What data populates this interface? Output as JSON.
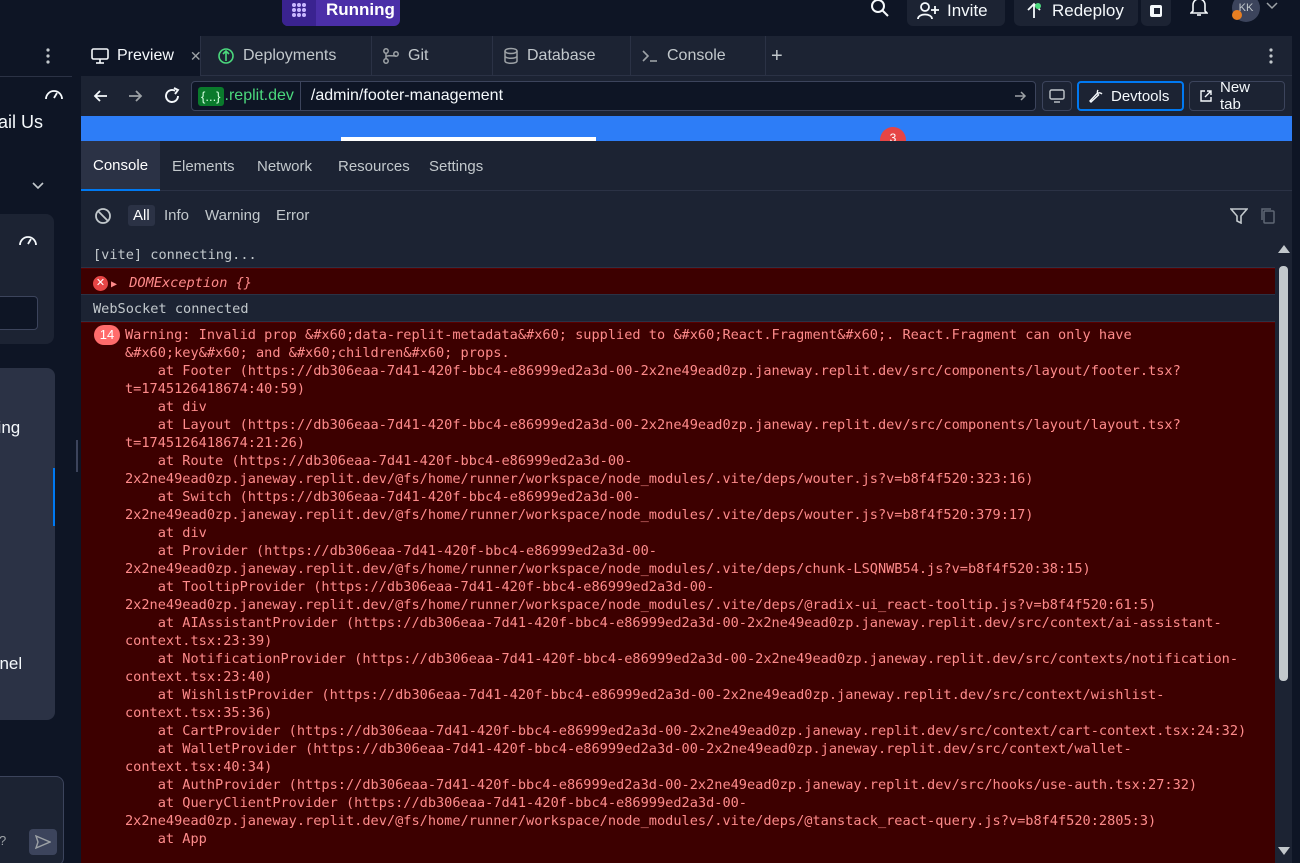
{
  "topbar": {
    "run_label": "Running",
    "invite_label": "Invite",
    "redeploy_label": "Redeploy",
    "avatar_initials": "KK"
  },
  "leftpane": {
    "text1": "ail Us",
    "text2": "iling",
    "text3": "anel",
    "input_placeholder": "?"
  },
  "tabs": [
    {
      "label": "Preview",
      "icon": "monitor-icon"
    },
    {
      "label": "Deployments",
      "icon": "deployments-icon"
    },
    {
      "label": "Git",
      "icon": "git-icon"
    },
    {
      "label": "Database",
      "icon": "database-icon"
    },
    {
      "label": "Console",
      "icon": "console-icon"
    }
  ],
  "urlbar": {
    "host_badge": "{...}",
    "host": ".replit.dev",
    "path": "/admin/footer-management",
    "devtools_label": "Devtools",
    "newtab_label": "New tab"
  },
  "blue_strip": {
    "notification_count": "3"
  },
  "devtools_tabs": [
    "Console",
    "Elements",
    "Network",
    "Resources",
    "Settings"
  ],
  "filters": [
    "All",
    "Info",
    "Warning",
    "Error"
  ],
  "console": {
    "line1": "[vite] connecting...",
    "line2": "DOMException {}",
    "line3": "WebSocket connected",
    "warning_count": "14",
    "warning_text": "Warning: Invalid prop &#x60;data-replit-metadata&#x60; supplied to &#x60;React.Fragment&#x60;. React.Fragment can only have\n&#x60;key&#x60; and &#x60;children&#x60; props.\n    at Footer (https://db306eaa-7d41-420f-bbc4-e86999ed2a3d-00-2x2ne49ead0zp.janeway.replit.dev/src/components/layout/footer.tsx?\nt=1745126418674:40:59)\n    at div\n    at Layout (https://db306eaa-7d41-420f-bbc4-e86999ed2a3d-00-2x2ne49ead0zp.janeway.replit.dev/src/components/layout/layout.tsx?\nt=1745126418674:21:26)\n    at Route (https://db306eaa-7d41-420f-bbc4-e86999ed2a3d-00-\n2x2ne49ead0zp.janeway.replit.dev/@fs/home/runner/workspace/node_modules/.vite/deps/wouter.js?v=b8f4f520:323:16)\n    at Switch (https://db306eaa-7d41-420f-bbc4-e86999ed2a3d-00-\n2x2ne49ead0zp.janeway.replit.dev/@fs/home/runner/workspace/node_modules/.vite/deps/wouter.js?v=b8f4f520:379:17)\n    at div\n    at Provider (https://db306eaa-7d41-420f-bbc4-e86999ed2a3d-00-\n2x2ne49ead0zp.janeway.replit.dev/@fs/home/runner/workspace/node_modules/.vite/deps/chunk-LSQNWB54.js?v=b8f4f520:38:15)\n    at TooltipProvider (https://db306eaa-7d41-420f-bbc4-e86999ed2a3d-00-\n2x2ne49ead0zp.janeway.replit.dev/@fs/home/runner/workspace/node_modules/.vite/deps/@radix-ui_react-tooltip.js?v=b8f4f520:61:5)\n    at AIAssistantProvider (https://db306eaa-7d41-420f-bbc4-e86999ed2a3d-00-2x2ne49ead0zp.janeway.replit.dev/src/context/ai-assistant-\ncontext.tsx:23:39)\n    at NotificationProvider (https://db306eaa-7d41-420f-bbc4-e86999ed2a3d-00-2x2ne49ead0zp.janeway.replit.dev/src/contexts/notification-\ncontext.tsx:23:40)\n    at WishlistProvider (https://db306eaa-7d41-420f-bbc4-e86999ed2a3d-00-2x2ne49ead0zp.janeway.replit.dev/src/context/wishlist-\ncontext.tsx:35:36)\n    at CartProvider (https://db306eaa-7d41-420f-bbc4-e86999ed2a3d-00-2x2ne49ead0zp.janeway.replit.dev/src/context/cart-context.tsx:24:32)\n    at WalletProvider (https://db306eaa-7d41-420f-bbc4-e86999ed2a3d-00-2x2ne49ead0zp.janeway.replit.dev/src/context/wallet-\ncontext.tsx:40:34)\n    at AuthProvider (https://db306eaa-7d41-420f-bbc4-e86999ed2a3d-00-2x2ne49ead0zp.janeway.replit.dev/src/hooks/use-auth.tsx:27:32)\n    at QueryClientProvider (https://db306eaa-7d41-420f-bbc4-e86999ed2a3d-00-\n2x2ne49ead0zp.janeway.replit.dev/@fs/home/runner/workspace/node_modules/.vite/deps/@tanstack_react-query.js?v=b8f4f520:2805:3)\n    at App"
  },
  "colors": {
    "accent": "#0079f2",
    "error_bg": "#3d0000",
    "error_text": "#ff8b8b",
    "running": "#4b2fa8"
  }
}
